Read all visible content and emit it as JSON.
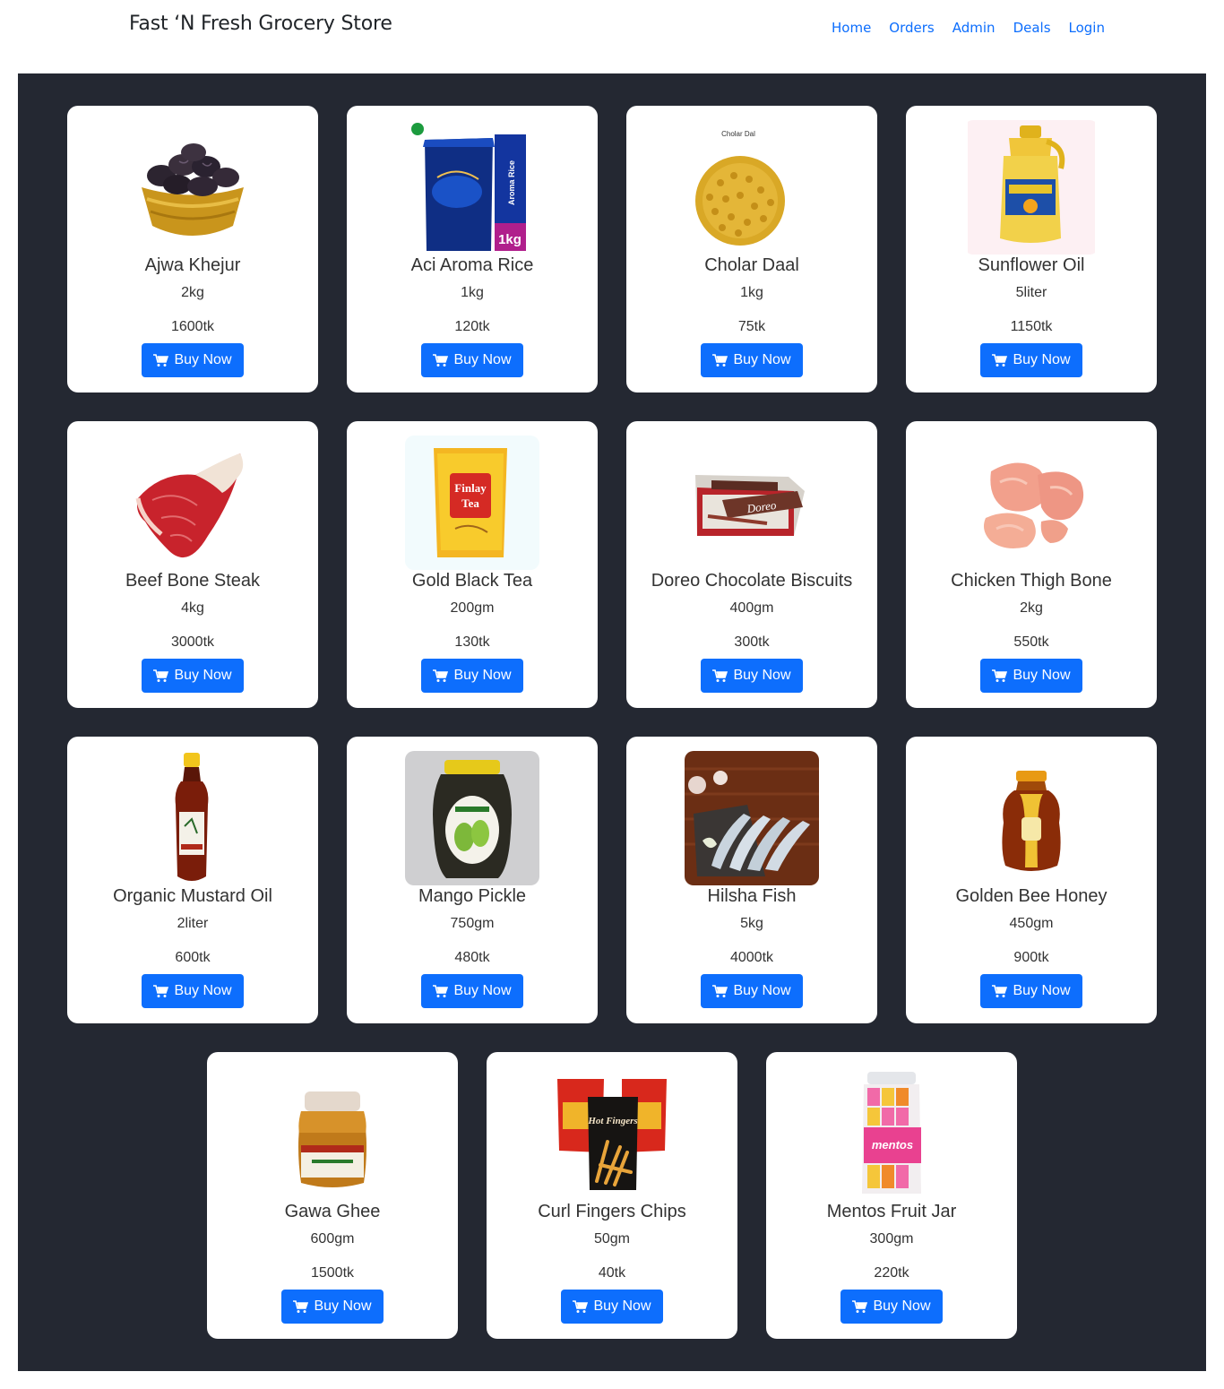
{
  "header": {
    "brand": "Fast ‘N Fresh Grocery Store",
    "nav": [
      "Home",
      "Orders",
      "Admin",
      "Deals",
      "Login"
    ]
  },
  "colors": {
    "accent": "#0d6efd",
    "page_bg": "#242832",
    "card_bg": "#ffffff"
  },
  "buy_label": "Buy Now",
  "products": [
    {
      "name": "Ajwa Khejur",
      "qty": "2kg",
      "price": "1600tk",
      "icon": "dates-bowl-icon"
    },
    {
      "name": "Aci Aroma Rice",
      "qty": "1kg",
      "price": "120tk",
      "icon": "rice-bag-icon",
      "pack_text": "1kg"
    },
    {
      "name": "Cholar Daal",
      "qty": "1kg",
      "price": "75tk",
      "icon": "lentils-icon",
      "pack_text": "Cholar Dal"
    },
    {
      "name": "Sunflower Oil",
      "qty": "5liter",
      "price": "1150tk",
      "icon": "oil-bottle-icon"
    },
    {
      "name": "Beef Bone Steak",
      "qty": "4kg",
      "price": "3000tk",
      "icon": "steak-icon"
    },
    {
      "name": "Gold Black Tea",
      "qty": "200gm",
      "price": "130tk",
      "icon": "tea-pack-icon",
      "pack_text": "Finlay Tea"
    },
    {
      "name": "Doreo Chocolate Biscuits",
      "qty": "400gm",
      "price": "300tk",
      "icon": "biscuit-box-icon",
      "pack_text": "Doreo"
    },
    {
      "name": "Chicken Thigh Bone",
      "qty": "2kg",
      "price": "550tk",
      "icon": "chicken-icon"
    },
    {
      "name": "Organic Mustard Oil",
      "qty": "2liter",
      "price": "600tk",
      "icon": "mustard-oil-bottle-icon"
    },
    {
      "name": "Mango Pickle",
      "qty": "750gm",
      "price": "480tk",
      "icon": "pickle-jar-icon"
    },
    {
      "name": "Hilsha Fish",
      "qty": "5kg",
      "price": "4000tk",
      "icon": "fish-icon"
    },
    {
      "name": "Golden Bee Honey",
      "qty": "450gm",
      "price": "900tk",
      "icon": "honey-jar-icon"
    },
    {
      "name": "Gawa Ghee",
      "qty": "600gm",
      "price": "1500tk",
      "icon": "ghee-jar-icon"
    },
    {
      "name": "Curl Fingers Chips",
      "qty": "50gm",
      "price": "40tk",
      "icon": "chips-pack-icon",
      "pack_text": "Hot Fingers"
    },
    {
      "name": "Mentos Fruit Jar",
      "qty": "300gm",
      "price": "220tk",
      "icon": "candy-jar-icon",
      "pack_text": "mentos"
    }
  ]
}
